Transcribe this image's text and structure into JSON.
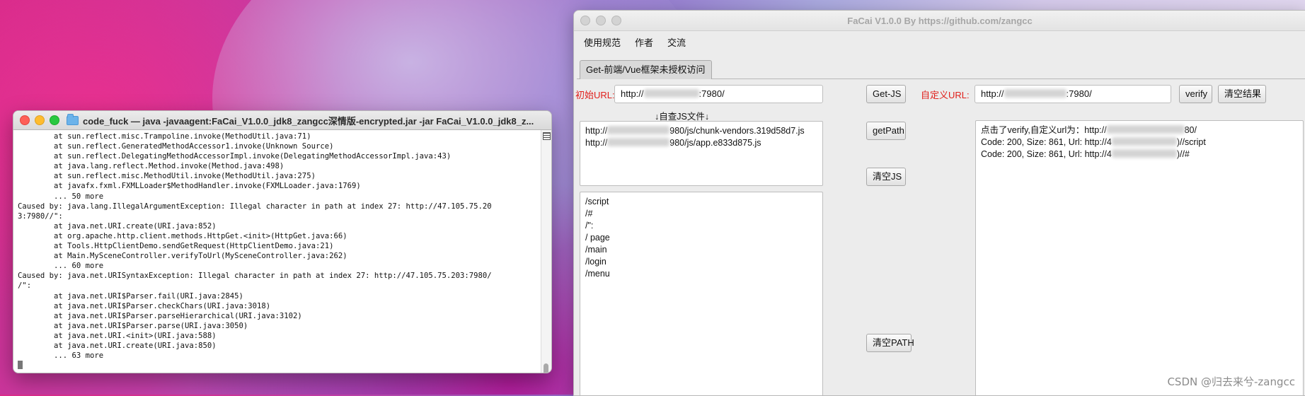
{
  "terminal": {
    "title": "code_fuck — java -javaagent:FaCai_V1.0.0_jdk8_zangcc深情版-encrypted.jar -jar FaCai_V1.0.0_jdk8_z...",
    "lines": [
      "        at sun.reflect.misc.Trampoline.invoke(MethodUtil.java:71)",
      "        at sun.reflect.GeneratedMethodAccessor1.invoke(Unknown Source)",
      "        at sun.reflect.DelegatingMethodAccessorImpl.invoke(DelegatingMethodAccessorImpl.java:43)",
      "        at java.lang.reflect.Method.invoke(Method.java:498)",
      "        at sun.reflect.misc.MethodUtil.invoke(MethodUtil.java:275)",
      "        at javafx.fxml.FXMLLoader$MethodHandler.invoke(FXMLLoader.java:1769)",
      "        ... 50 more",
      "Caused by: java.lang.IllegalArgumentException: Illegal character in path at index 27: http://47.105.75.20",
      "3:7980//\":",
      "        at java.net.URI.create(URI.java:852)",
      "        at org.apache.http.client.methods.HttpGet.<init>(HttpGet.java:66)",
      "        at Tools.HttpClientDemo.sendGetRequest(HttpClientDemo.java:21)",
      "        at Main.MySceneController.verifyToUrl(MySceneController.java:262)",
      "        ... 60 more",
      "Caused by: java.net.URISyntaxException: Illegal character in path at index 27: http://47.105.75.203:7980/",
      "/\":",
      "        at java.net.URI$Parser.fail(URI.java:2845)",
      "        at java.net.URI$Parser.checkChars(URI.java:3018)",
      "        at java.net.URI$Parser.parseHierarchical(URI.java:3102)",
      "        at java.net.URI$Parser.parse(URI.java:3050)",
      "        at java.net.URI.<init>(URI.java:588)",
      "        at java.net.URI.create(URI.java:850)",
      "        ... 63 more"
    ]
  },
  "facai": {
    "title": "FaCai V1.0.0 By https://github.com/zangcc",
    "menu": [
      "使用规范",
      "作者",
      "交流"
    ],
    "tab": "Get-前端/Vue框架未授权访问",
    "initial_url_label": "初始URL:",
    "initial_url_prefix": "http://",
    "initial_url_suffix": ":7980/",
    "get_js_button": "Get-JS",
    "custom_url_label": "自定义URL:",
    "custom_url_prefix": "http://",
    "custom_url_suffix": ":7980/",
    "verify_button": "verify",
    "clear_result_button": "清空结果",
    "js_hint": "↓自查JS文件↓",
    "js_files": [
      {
        "prefix": "http://",
        "suffix": "980/js/chunk-vendors.319d58d7.js"
      },
      {
        "prefix": "http://",
        "suffix": "980/js/app.e833d875.js"
      }
    ],
    "get_path_button": "getPath",
    "clear_js_button": "清空JS",
    "paths": [
      "/script",
      "/#",
      "/\":",
      "/ page",
      "/main",
      "/login",
      "/menu"
    ],
    "clear_path_button": "清空PATH",
    "results": [
      {
        "prefix": "点击了verify,自定义url为：http://",
        "suffix": "80/"
      },
      {
        "prefix": "Code: 200, Size: 861, Url: http://4",
        "suffix": ")//script"
      },
      {
        "prefix": "Code: 200, Size: 861, Url: http://4",
        "suffix": ")//#"
      }
    ]
  },
  "watermark": "CSDN @归去来兮-zangcc"
}
